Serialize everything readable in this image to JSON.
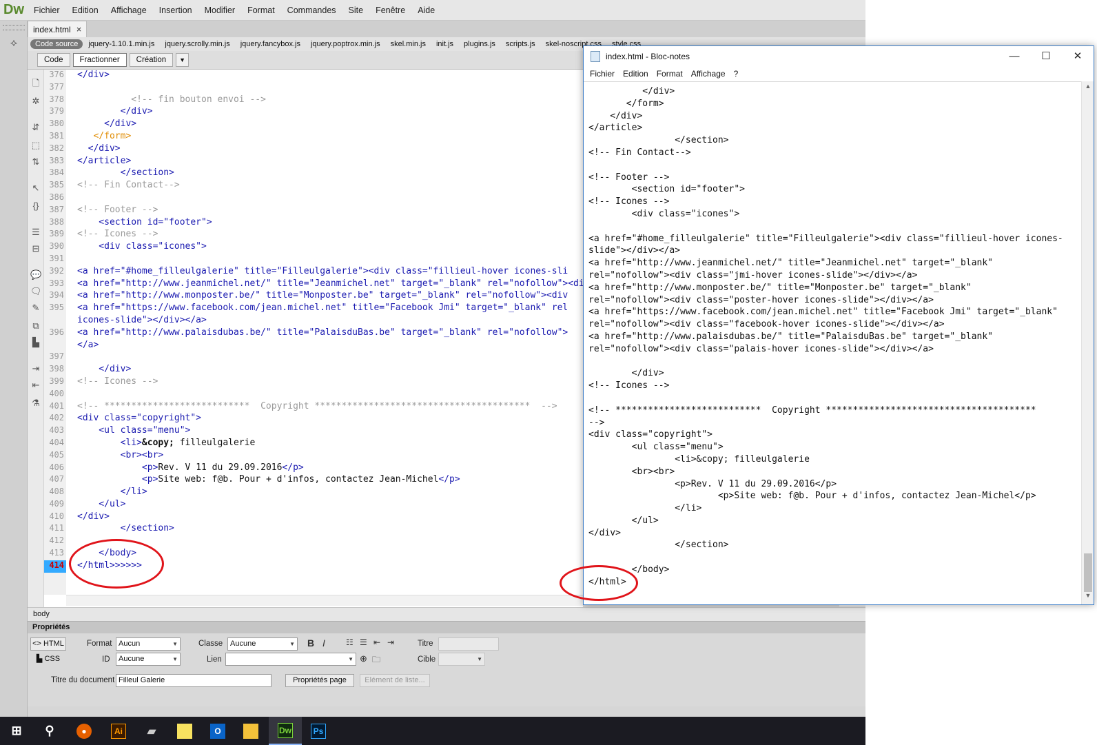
{
  "dw": {
    "logo": "Dw",
    "menu": [
      "Fichier",
      "Edition",
      "Affichage",
      "Insertion",
      "Modifier",
      "Format",
      "Commandes",
      "Site",
      "Fenêtre",
      "Aide"
    ],
    "tab_name": "index.html",
    "tab_close": "×",
    "source_label": "Code source",
    "related_files": [
      "jquery-1.10.1.min.js",
      "jquery.scrolly.min.js",
      "jquery.fancybox.js",
      "jquery.poptrox.min.js",
      "skel.min.js",
      "init.js",
      "plugins.js",
      "scripts.js",
      "skel-noscript.css",
      "style.css"
    ],
    "view_buttons": [
      "Code",
      "Fractionner",
      "Création"
    ],
    "line_numbers": [
      "376",
      "377",
      "378",
      "379",
      "380",
      "381",
      "382",
      "383",
      "384",
      "385",
      "386",
      "387",
      "388",
      "389",
      "390",
      "391",
      "392",
      "393",
      "394",
      "395",
      "",
      "396",
      "",
      "397",
      "398",
      "399",
      "400",
      "401",
      "402",
      "403",
      "404",
      "405",
      "406",
      "407",
      "408",
      "409",
      "410",
      "411",
      "412",
      "413",
      "414"
    ],
    "current_line": "414",
    "code_lines": [
      "</div>",
      "",
      "          <!-- fin bouton envoi -->",
      "        </div>",
      "     </div>",
      "   </form>",
      "  </div>",
      "</article>",
      "        </section>",
      "<!-- Fin Contact-->",
      "",
      "<!-- Footer -->",
      "    <section id=\"footer\">",
      "<!-- Icones -->",
      "    <div class=\"icones\">",
      "",
      "<a href=\"#home_filleulgalerie\" title=\"Filleulgalerie\"><div class=\"fillieul-hover icones-sli",
      "<a href=\"http://www.jeanmichel.net/\" title=\"Jeanmichel.net\" target=\"_blank\" rel=\"nofollow\"><div",
      "<a href=\"http://www.monposter.be/\" title=\"Monposter.be\" target=\"_blank\" rel=\"nofollow\"><div",
      "<a href=\"https://www.facebook.com/jean.michel.net\" title=\"Facebook Jmi\" target=\"_blank\" rel",
      "icones-slide\"></div></a>",
      "<a href=\"http://www.palaisdubas.be/\" title=\"PalaisduBas.be\" target=\"_blank\" rel=\"nofollow\">",
      "</a>",
      "",
      "    </div>",
      "<!-- Icones -->",
      "",
      "<!-- ***************************  Copyright ****************************************  -->",
      "<div class=\"copyright\">",
      "    <ul class=\"menu\">",
      "        <li>&copy; filleulgalerie",
      "        <br><br>",
      "            <p>Rev. V 11 du 29.09.2016</p>",
      "            <p>Site web: f@b. Pour + d'infos, contactez Jean-Michel</p>",
      "        </li>",
      "    </ul>",
      "</div>",
      "        </section>",
      "",
      "    </body>",
      "</html>>>>>>"
    ],
    "status_tag": "body",
    "hscroll_arrow": "<",
    "properties": {
      "title": "Propriétés",
      "html_btn": "HTML",
      "css_btn": "CSS",
      "format_label": "Format",
      "format_value": "Aucun",
      "id_label": "ID",
      "id_value": "Aucune",
      "classe_label": "Classe",
      "classe_value": "Aucune",
      "lien_label": "Lien",
      "lien_value": "",
      "titre_label": "Titre",
      "cible_label": "Cible",
      "doc_title_label": "Titre du document",
      "doc_title_value": "Filleul Galerie",
      "page_props_btn": "Propriétés page",
      "list_item_btn": "Elément de liste..."
    }
  },
  "taskbar": {
    "apps": [
      "Windows",
      "Rechercher",
      "Firefox",
      "Ai",
      "Disque",
      "Notes",
      "Outlook",
      "Explorateur",
      "Dw",
      "Ps"
    ],
    "active": "Dw"
  },
  "notepad": {
    "title": "index.html - Bloc-notes",
    "menu": [
      "Fichier",
      "Edition",
      "Format",
      "Affichage",
      "?"
    ],
    "lines": [
      "          </div>",
      "       </form>",
      "    </div>",
      "</article>",
      "                </section>",
      "<!-- Fin Contact-->",
      "",
      "<!-- Footer -->",
      "        <section id=\"footer\">",
      "<!-- Icones -->",
      "        <div class=\"icones\">",
      "",
      "<a href=\"#home_filleulgalerie\" title=\"Filleulgalerie\"><div class=\"fillieul-hover icones-",
      "slide\"></div></a>",
      "<a href=\"http://www.jeanmichel.net/\" title=\"Jeanmichel.net\" target=\"_blank\"",
      "rel=\"nofollow\"><div class=\"jmi-hover icones-slide\"></div></a>",
      "<a href=\"http://www.monposter.be/\" title=\"Monposter.be\" target=\"_blank\"",
      "rel=\"nofollow\"><div class=\"poster-hover icones-slide\"></div></a>",
      "<a href=\"https://www.facebook.com/jean.michel.net\" title=\"Facebook Jmi\" target=\"_blank\"",
      "rel=\"nofollow\"><div class=\"facebook-hover icones-slide\"></div></a>",
      "<a href=\"http://www.palaisdubas.be/\" title=\"PalaisduBas.be\" target=\"_blank\"",
      "rel=\"nofollow\"><div class=\"palais-hover icones-slide\"></div></a>",
      "",
      "        </div>",
      "<!-- Icones -->",
      "",
      "<!-- ***************************  Copyright ***************************************",
      "-->",
      "<div class=\"copyright\">",
      "        <ul class=\"menu\">",
      "                <li>&copy; filleulgalerie",
      "        <br><br>",
      "                <p>Rev. V 11 du 29.09.2016</p>",
      "                        <p>Site web: f@b. Pour + d'infos, contactez Jean-Michel</p>",
      "                </li>",
      "        </ul>",
      "</div>",
      "                </section>",
      "",
      "        </body>",
      "</html>"
    ]
  },
  "colors": {
    "annotation_red": "#e0141a",
    "tag_blue": "#1a1ab0",
    "comment_gray": "#9a9a9a",
    "form_orange": "#e08b00"
  }
}
